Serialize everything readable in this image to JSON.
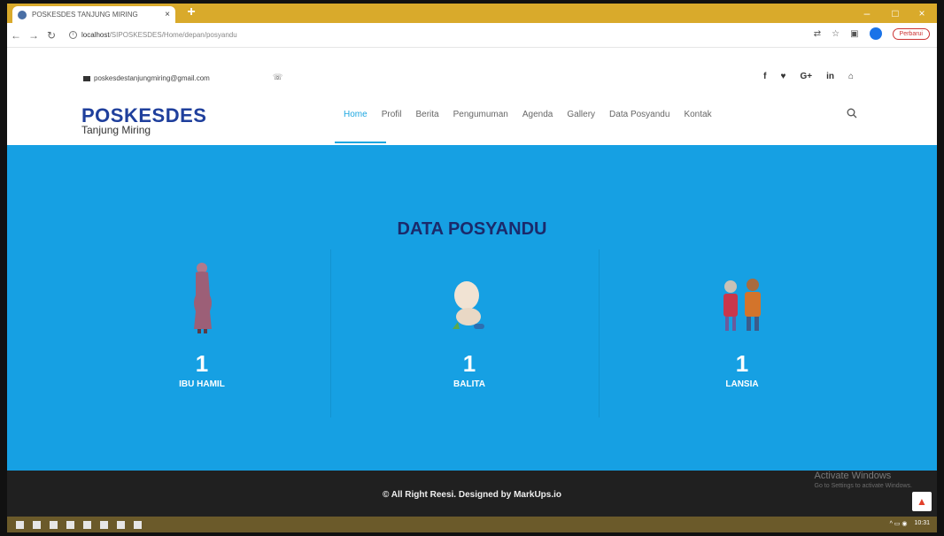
{
  "browser": {
    "tab_title": "POSKESDES TANJUNG MIRING",
    "tab_close": "×",
    "new_tab": "+",
    "url_host": "localhost",
    "url_path": "/SIPOSKESDES/Home/depan/posyandu",
    "update_label": "Perbarui",
    "win_min": "–",
    "win_max": "□",
    "win_close": "×"
  },
  "topinfo": {
    "email": "poskesdestanjungmiring@gmail.com",
    "phone_icon": "phone-icon",
    "socials": [
      "f",
      "♥",
      "G+",
      "in",
      "⌂"
    ]
  },
  "header": {
    "logo_title": "POSKESDES",
    "logo_sub": "Tanjung Miring",
    "nav": [
      "Home",
      "Profil",
      "Berita",
      "Pengumuman",
      "Agenda",
      "Gallery",
      "Data Posyandu",
      "Kontak"
    ],
    "active_index": 0
  },
  "hero": {
    "title": "DATA POSYANDU",
    "stats": [
      {
        "value": "1",
        "label": "IBU HAMIL",
        "icon": "pregnant-woman-icon"
      },
      {
        "value": "1",
        "label": "BALITA",
        "icon": "baby-icon"
      },
      {
        "value": "1",
        "label": "LANSIA",
        "icon": "elderly-couple-icon"
      }
    ]
  },
  "footer": {
    "copyright": "© All Right Reesi. Designed by MarkUps.io",
    "watermark_title": "Activate Windows",
    "watermark_sub": "Go to Settings to activate Windows."
  },
  "taskbar": {
    "time": "10:31"
  },
  "colors": {
    "hero_bg": "#16a0e3",
    "title_color": "#1b2a6b",
    "logo_color": "#1f3f9c",
    "active_nav": "#1ea7e0",
    "footer_bg": "#202020",
    "tab_strip": "#d9aa2b"
  }
}
